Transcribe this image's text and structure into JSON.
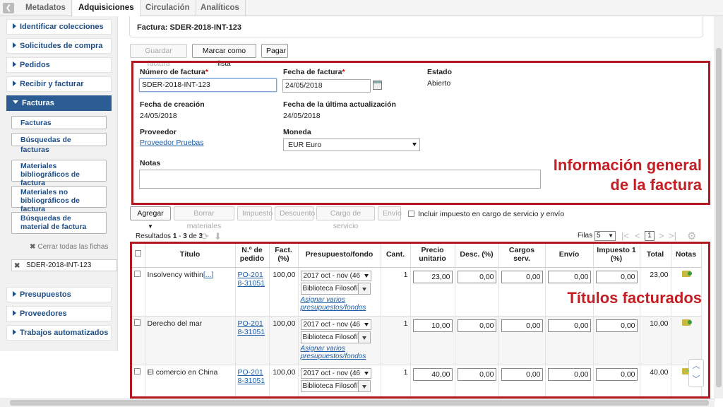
{
  "top_tabs": [
    {
      "label": "Metadatos",
      "active": false
    },
    {
      "label": "Adquisiciones",
      "active": true
    },
    {
      "label": "Circulación",
      "active": false
    },
    {
      "label": "Analíticos",
      "active": false
    }
  ],
  "sidebar": {
    "items": [
      {
        "label": "Identificar colecciones"
      },
      {
        "label": "Solicitudes de compra"
      },
      {
        "label": "Pedidos"
      },
      {
        "label": "Recibir y facturar"
      },
      {
        "label": "Facturas"
      },
      {
        "label": "Presupuestos"
      },
      {
        "label": "Proveedores"
      },
      {
        "label": "Trabajos automatizados"
      }
    ],
    "sub_buttons": [
      "Facturas",
      "Búsquedas de facturas",
      "Materiales bibliográficos de factura",
      "Materiales no bibliográficos de factura",
      "Búsquedas de material de factura"
    ],
    "close_all": "Cerrar todas las fichas",
    "open_tab": "SDER-2018-INT-123"
  },
  "invoice": {
    "title": "Factura: SDER-2018-INT-123",
    "buttons": {
      "save": "Guardar factura",
      "mark_list": "Marcar como lista",
      "pay": "Pagar"
    },
    "labels": {
      "number": "Número de factura",
      "date": "Fecha de factura",
      "status": "Estado",
      "created": "Fecha de creación",
      "updated": "Fecha de la última actualización",
      "vendor": "Proveedor",
      "currency": "Moneda",
      "notes": "Notas"
    },
    "values": {
      "number": "SDER-2018-INT-123",
      "date": "24/05/2018",
      "status": "Abierto",
      "created": "24/05/2018",
      "updated": "24/05/2018",
      "vendor": "Proveedor Pruebas",
      "currency": "EUR Euro",
      "notes": ""
    },
    "required_mark": "*"
  },
  "annotations": {
    "general_line1": "Información general",
    "general_line2": "de la factura",
    "titles": "Títulos facturados"
  },
  "toolbar": {
    "add": "Agregar",
    "delete": "Borrar materiales",
    "tax": "Impuesto",
    "discount": "Descuento",
    "service": "Cargo de servicio",
    "shipping": "Envío",
    "include_tax_label": "Incluir impuesto en cargo de servicio y envío"
  },
  "results": {
    "label": "Resultados",
    "from": "1",
    "to": "3",
    "of": "de",
    "total": "3",
    "rows_label": "Filas",
    "rows_value": "5",
    "page": "1"
  },
  "table": {
    "headers": [
      "Título",
      "N.º de pedido",
      "Fact. (%)",
      "Presupuesto/fondo",
      "Cant.",
      "Precio unitario",
      "Desc. (%)",
      "Cargos serv.",
      "Envío",
      "Impuesto 1 (%)",
      "Total",
      "Notas"
    ],
    "assign_link": "Asignar varios presupuestos/fondos",
    "rows": [
      {
        "title": "Insolvency within",
        "more": "[...]",
        "order": "PO-2018-31051",
        "fact": "100,00",
        "budget": "2017 oct - nov (46",
        "fund": "Biblioteca Filosofía",
        "qty": "1",
        "price": "23,00",
        "disc": "0,00",
        "serv": "0,00",
        "ship": "0,00",
        "tax": "0,00",
        "total": "23,00"
      },
      {
        "title": "Derecho del mar",
        "more": "",
        "order": "PO-2018-31051",
        "fact": "100,00",
        "budget": "2017 oct - nov (46",
        "fund": "Biblioteca Filosofía",
        "qty": "1",
        "price": "10,00",
        "disc": "0,00",
        "serv": "0,00",
        "ship": "0,00",
        "tax": "0,00",
        "total": "10,00"
      },
      {
        "title": "El comercio en China",
        "more": "",
        "order": "PO-2018-31051",
        "fact": "100,00",
        "budget": "2017 oct - nov (46",
        "fund": "Biblioteca Filosofía",
        "qty": "1",
        "price": "40,00",
        "disc": "0,00",
        "serv": "0,00",
        "ship": "0,00",
        "tax": "0,00",
        "total": "40,00"
      }
    ]
  },
  "colors": {
    "accent": "#2b5d94",
    "annotation": "#c41e24",
    "link": "#1f5ea8"
  }
}
